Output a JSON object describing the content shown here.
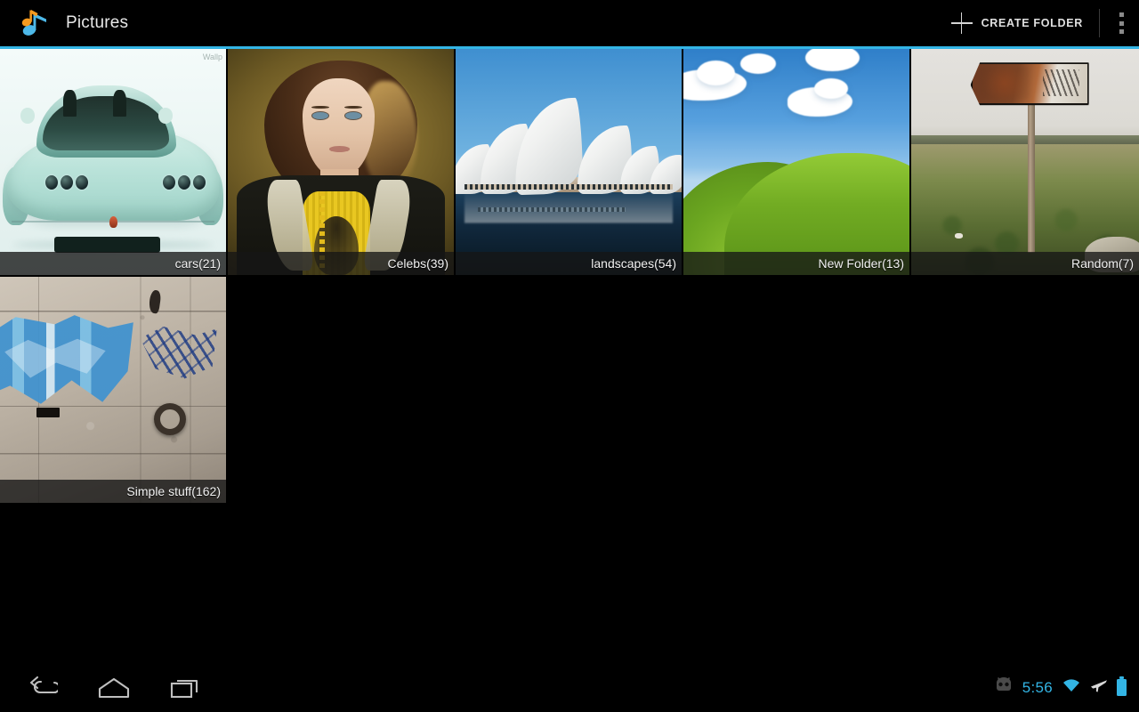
{
  "actionbar": {
    "app_icon_name": "music-note-icon",
    "title": "Pictures",
    "create_folder_label": "CREATE FOLDER",
    "plus_icon": "plus-icon",
    "overflow_icon": "overflow-menu-icon",
    "accent_color": "#33b5e5"
  },
  "grid": {
    "folders": [
      {
        "label": "cars(21)",
        "name": "cars",
        "count": 21,
        "watermark": "Wallp",
        "art": "mint-sports-car-on-white"
      },
      {
        "label": "Celebs(39)",
        "name": "Celebs",
        "count": 39,
        "art": "woman-portrait-yellow-top-dark-jacket"
      },
      {
        "label": "landscapes(54)",
        "name": "landscapes",
        "count": 54,
        "art": "sydney-opera-house-blue-sky-water-reflection"
      },
      {
        "label": "New Folder(13)",
        "name": "New Folder",
        "count": 13,
        "art": "green-hills-blue-sky-clouds"
      },
      {
        "label": "Random(7)",
        "name": "Random",
        "count": 7,
        "art": "rusty-signpost-in-field"
      },
      {
        "label": "Simple stuff(162)",
        "name": "Simple stuff",
        "count": 162,
        "art": "blue-graffiti-on-concrete-wall"
      }
    ]
  },
  "navbar": {
    "back_label": "Back",
    "home_label": "Home",
    "recents_label": "Recent apps",
    "status": {
      "robot_icon": "cyanogenmod-robot-icon",
      "clock": "5:56",
      "wifi_icon": "wifi-icon",
      "airplane_icon": "airplane-mode-icon",
      "battery_icon": "battery-full-icon",
      "accent_color": "#33b5e5"
    }
  }
}
